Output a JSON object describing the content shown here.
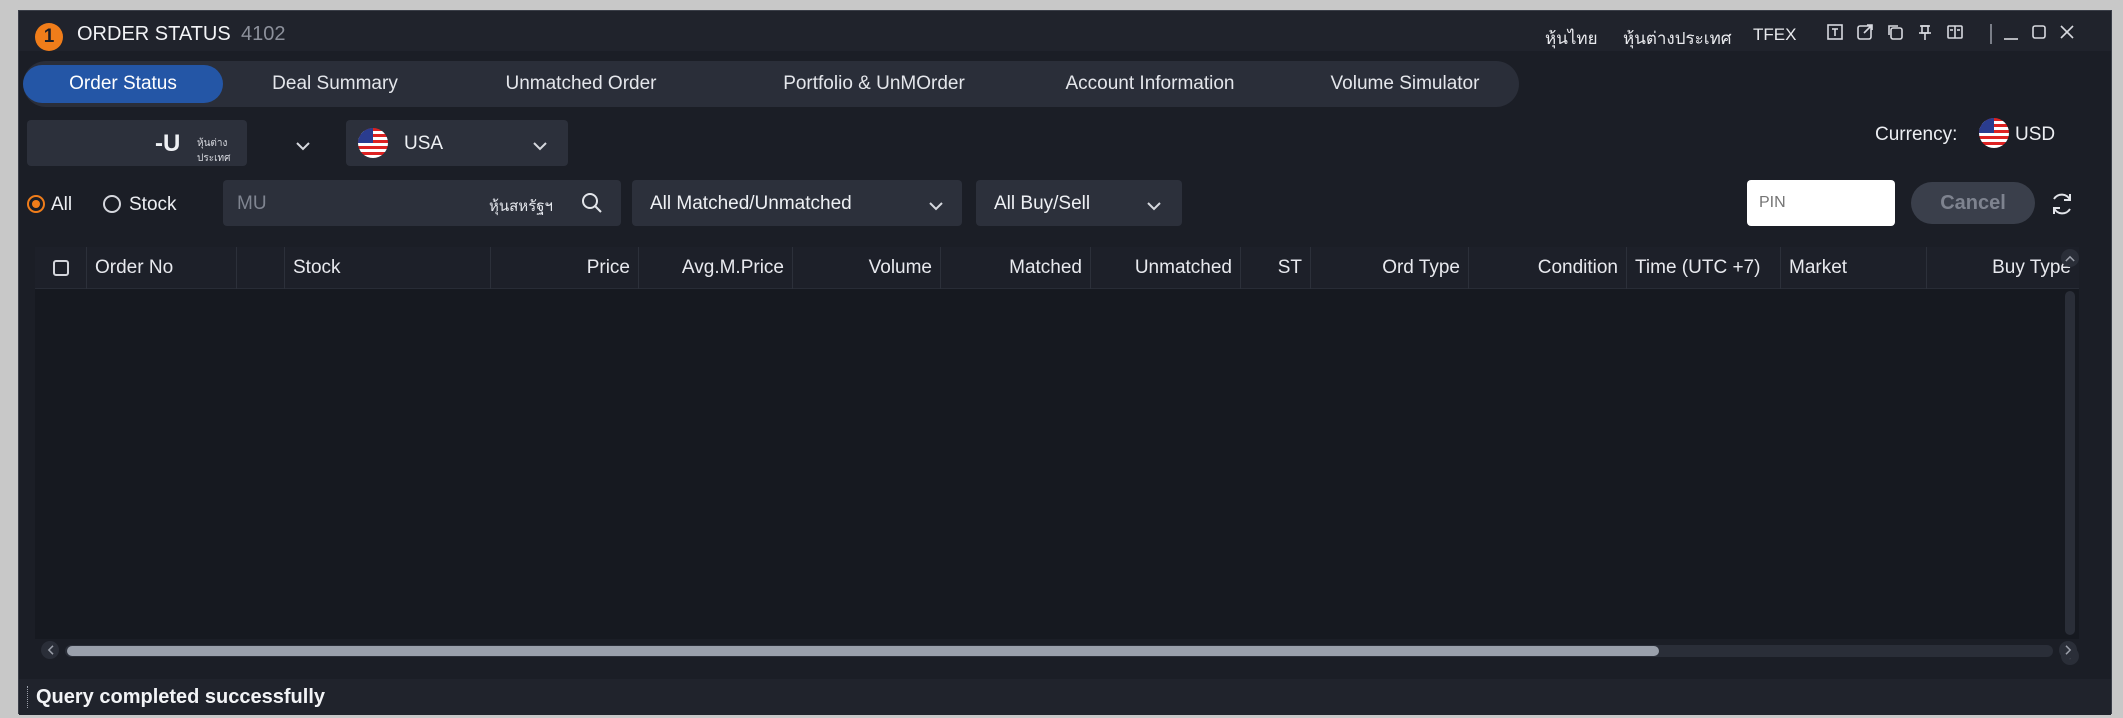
{
  "window": {
    "badge": "1",
    "title": "ORDER STATUS",
    "title_num": "4102",
    "market_links": [
      "หุ้นไทย",
      "หุ้นต่างประเทศ",
      "TFEX"
    ],
    "icons": [
      "layout-icon",
      "popout-icon",
      "duplicate-icon",
      "pin-icon",
      "book-icon",
      "minimize-icon",
      "maximize-icon",
      "close-icon"
    ]
  },
  "tabs": [
    {
      "label": "Order Status",
      "active": true
    },
    {
      "label": "Deal Summary",
      "active": false
    },
    {
      "label": "Unmatched Order",
      "active": false
    },
    {
      "label": "Portfolio & UnMOrder",
      "active": false
    },
    {
      "label": "Account Information",
      "active": false
    },
    {
      "label": "Volume Simulator",
      "active": false
    }
  ],
  "account": {
    "value": "-U",
    "sub": "หุ้นต่างประเทศ"
  },
  "country": {
    "value": "USA"
  },
  "currency": {
    "label": "Currency:",
    "value": "USD"
  },
  "filters": {
    "radio_all": "All",
    "radio_stock": "Stock",
    "search_placeholder": "MU",
    "search_market": "หุ้นสหรัฐฯ",
    "matched": "All Matched/Unmatched",
    "buysell": "All Buy/Sell",
    "pin_placeholder": "PIN",
    "cancel": "Cancel"
  },
  "table": {
    "columns": [
      "Order No",
      "",
      "Stock",
      "Price",
      "Avg.M.Price",
      "Volume",
      "Matched",
      "Unmatched",
      "ST",
      "Ord Type",
      "Condition",
      "Time (UTC +7)",
      "Market",
      "Buy Type"
    ],
    "rows": []
  },
  "status": {
    "message": "Query completed successfully"
  },
  "colors": {
    "accent": "#f07d1a",
    "tab_active": "#2456a6",
    "bg": "#1b1e26"
  }
}
